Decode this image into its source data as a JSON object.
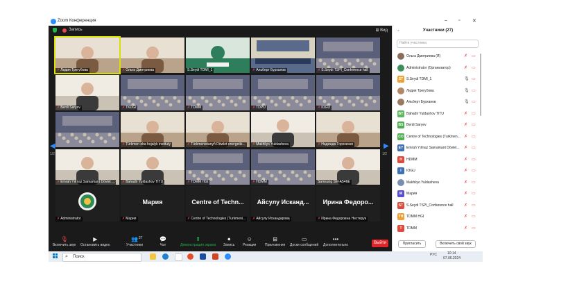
{
  "window": {
    "title": "Zoom Конференция",
    "min": "–",
    "max": "▫",
    "close": "✕"
  },
  "topbar": {
    "record_label": "Запись",
    "view_label": "⊞ Вид"
  },
  "tiles": [
    {
      "name": "Лидия Трегубова",
      "type": "video",
      "scene": "office",
      "active": true,
      "muted": true
    },
    {
      "name": "Ольга Дмитриева",
      "type": "video",
      "scene": "office",
      "muted": true
    },
    {
      "name": "S.Seydi TDMI_1",
      "type": "video",
      "scene": "logo",
      "muted": false
    },
    {
      "name": "Альберт Бурханов",
      "type": "video",
      "scene": "panel",
      "muted": true
    },
    {
      "name": "S.Seydi TSPI_Conference hall",
      "type": "video",
      "scene": "hall",
      "muted": true
    },
    {
      "name": "Berdi Saryev",
      "type": "video",
      "scene": "person",
      "muted": true
    },
    {
      "name": "TKDGI",
      "type": "video",
      "scene": "hall",
      "muted": true
    },
    {
      "name": "TDMM",
      "type": "video",
      "scene": "hall",
      "muted": true
    },
    {
      "name": "TDPU",
      "type": "video",
      "scene": "hall",
      "muted": true
    },
    {
      "name": "IOGU",
      "type": "video",
      "scene": "hall",
      "muted": true
    },
    {
      "name": "",
      "type": "video",
      "scene": "hall",
      "muted": false
    },
    {
      "name": "Türkmen oba hojalyk instituty",
      "type": "video",
      "scene": "office",
      "muted": true
    },
    {
      "name": "Türkmenistanyň Döwlet energetik...",
      "type": "video",
      "scene": "office",
      "muted": true
    },
    {
      "name": "Makhliyo Yuldasheva",
      "type": "video",
      "scene": "person",
      "muted": true
    },
    {
      "name": "Надежда Горохенко",
      "type": "video",
      "scene": "office",
      "muted": true
    },
    {
      "name": "Emrah Yılmaz Samarkant Dövlet ...",
      "type": "video",
      "scene": "person",
      "muted": true
    },
    {
      "name": "Bahadir Yuldashov TITU",
      "type": "video",
      "scene": "person",
      "muted": true
    },
    {
      "name": "TDMM HGI",
      "type": "video",
      "scene": "hall",
      "muted": true
    },
    {
      "name": "HDMM",
      "type": "video",
      "scene": "hall",
      "muted": true
    },
    {
      "name": "Samsung SM-A546E",
      "type": "video",
      "scene": "person",
      "muted": false
    },
    {
      "name": "Administrator",
      "type": "logo",
      "big": "",
      "muted": true
    },
    {
      "name": "Мария",
      "type": "blank",
      "big": "Мария",
      "muted": true
    },
    {
      "name": "Centre of Technologies (Turkmeni...",
      "type": "blank",
      "big": "Centre of Techn...",
      "muted": true
    },
    {
      "name": "Айсулу Искандарова",
      "type": "blank",
      "big": "Айсулу Исканд...",
      "muted": true
    },
    {
      "name": "Ирина Федоровна Нестерук",
      "type": "blank",
      "big": "Ирина Федоро...",
      "muted": true
    }
  ],
  "pager": {
    "left": "1/2",
    "right": "1/2"
  },
  "toolbar": {
    "items": [
      {
        "label": "Включить звук",
        "icon": "🎙"
      },
      {
        "label": "Остановить видео",
        "icon": "▶"
      },
      {
        "label": "Участники",
        "icon": "👥",
        "count": "27"
      },
      {
        "label": "Чат",
        "icon": "💬"
      },
      {
        "label": "Демонстрация экрана",
        "icon": "⬆"
      },
      {
        "label": "Запись",
        "icon": "⏺"
      },
      {
        "label": "Реакции",
        "icon": "☺"
      },
      {
        "label": "Приложения",
        "icon": "⊞"
      },
      {
        "label": "Доски сообщений",
        "icon": "▭"
      },
      {
        "label": "Дополнительно",
        "icon": "•••"
      }
    ],
    "exit_label": "Выйти"
  },
  "panel": {
    "title": "Участники (27)",
    "search_placeholder": "Найти участника",
    "participants": [
      {
        "name": "Ольга Дмитриева (Я)",
        "initials": "",
        "color": "#8a6d5a",
        "mic_on": false
      },
      {
        "name": "Administrator (Организатор)",
        "initials": "",
        "color": "#3a8f5a",
        "mic_on": false
      },
      {
        "name": "S.Seydi TDMI_1",
        "initials": "ST",
        "color": "#f0a030",
        "mic_on": true
      },
      {
        "name": "Лидия Трегубова",
        "initials": "",
        "color": "#b08868",
        "mic_on": true
      },
      {
        "name": "Альберт Бурханов",
        "initials": "",
        "color": "#9a7a60",
        "mic_on": true
      },
      {
        "name": "Bahadir Yuldashov TITU",
        "initials": "BY",
        "color": "#5bb85b",
        "mic_on": false
      },
      {
        "name": "Berdi Saryev",
        "initials": "BS",
        "color": "#4caf50",
        "mic_on": false
      },
      {
        "name": "Centre of Technologies (Turkmen...",
        "initials": "CO",
        "color": "#4caf50",
        "mic_on": false
      },
      {
        "name": "Emrah Yılmaz Samarkant Dövlet...",
        "initials": "EY",
        "color": "#3f6fb5",
        "mic_on": false
      },
      {
        "name": "HDMM",
        "initials": "H",
        "color": "#e04a3a",
        "mic_on": false
      },
      {
        "name": "IOGU",
        "initials": "I",
        "color": "#3f6fb5",
        "mic_on": false
      },
      {
        "name": "Makhliyo Yuldasheva",
        "initials": "",
        "color": "#7a8fb0",
        "mic_on": false
      },
      {
        "name": "Мария",
        "initials": "M",
        "color": "#5a4fcf",
        "mic_on": false
      },
      {
        "name": "S.Seydi TSPI_Conference hall",
        "initials": "ST",
        "color": "#e04a3a",
        "mic_on": false
      },
      {
        "name": "TDMM HGI",
        "initials": "TH",
        "color": "#f0a030",
        "mic_on": false
      },
      {
        "name": "TDMM",
        "initials": "T",
        "color": "#e04a3a",
        "mic_on": false
      }
    ],
    "invite_label": "Пригласить",
    "unmute_label": "Включить свой звук"
  },
  "taskbar": {
    "search_label": "Поиск",
    "lang": "РУС",
    "time": "10:14",
    "date": "07.06.2024"
  }
}
